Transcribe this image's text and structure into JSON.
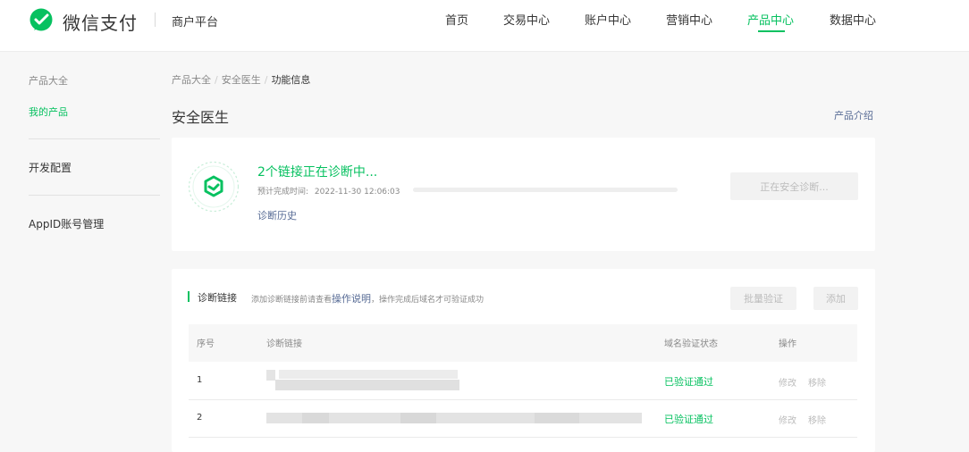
{
  "header": {
    "brand": "微信支付",
    "platform": "商户平台",
    "nav": [
      "首页",
      "交易中心",
      "账户中心",
      "营销中心",
      "产品中心",
      "数据中心"
    ],
    "active_nav": "产品中心",
    "accent_color": "#07c160"
  },
  "sidebar": {
    "items": [
      {
        "label": "产品大全"
      },
      {
        "label": "我的产品"
      },
      {
        "label": "开发配置"
      },
      {
        "label": "AppID账号管理"
      }
    ]
  },
  "breadcrumb": [
    "产品大全",
    "安全医生",
    "功能信息"
  ],
  "page": {
    "title": "安全医生",
    "intro_link": "产品介绍"
  },
  "diagnosis": {
    "title": "2个链接正在诊断中...",
    "eta_label": "预计完成时间:",
    "eta_value": "2022-11-30 12:06:03",
    "history_link": "诊断历史",
    "button": "正在安全诊断...",
    "progress_fraction": 0
  },
  "links_section": {
    "title": "诊断链接",
    "hint_prefix": "添加诊断链接前请查看",
    "hint_link": "操作说明",
    "hint_suffix": "，操作完成后域名才可验证成功",
    "batch_button": "批量验证",
    "add_button": "添加",
    "columns": [
      "序号",
      "诊断链接",
      "域名验证状态",
      "操作"
    ],
    "rows": [
      {
        "index": "1",
        "status": "已验证通过",
        "edit": "修改",
        "remove": "移除"
      },
      {
        "index": "2",
        "status": "已验证通过",
        "edit": "修改",
        "remove": "移除"
      }
    ]
  }
}
